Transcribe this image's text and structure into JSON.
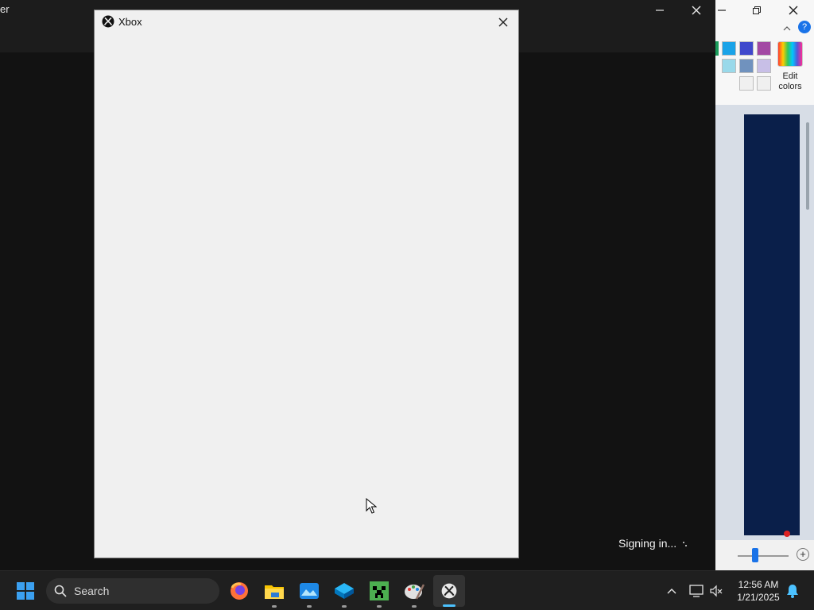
{
  "launcher": {
    "title_fragment": "er",
    "status_text": "Signing in...",
    "controls": {
      "minimize": "minimize-icon",
      "close": "close-icon"
    }
  },
  "xbox_dialog": {
    "title": "Xbox",
    "logo_icon": "xbox-logo-icon",
    "close_icon": "close-icon"
  },
  "paint": {
    "edit_colors_label": "Edit colors",
    "controls": {
      "minimize": "minimize-icon",
      "restore": "restore-icon",
      "close": "close-icon"
    },
    "palette": [
      "#1aa3e8",
      "#3f48cc",
      "#a349a4",
      "#99d9ea",
      "#7092be",
      "#c8bfe7",
      "#f0f0f0",
      "#f0f0f0"
    ],
    "accent": "#0a1f4a"
  },
  "taskbar": {
    "search_placeholder": "Search",
    "time": "12:56 AM",
    "date": "1/21/2025",
    "apps": [
      "windows-start-icon",
      "firefox-icon",
      "file-explorer-icon",
      "photos-icon",
      "sketch-icon",
      "minecraft-icon",
      "paint-icon",
      "xbox-icon"
    ]
  }
}
